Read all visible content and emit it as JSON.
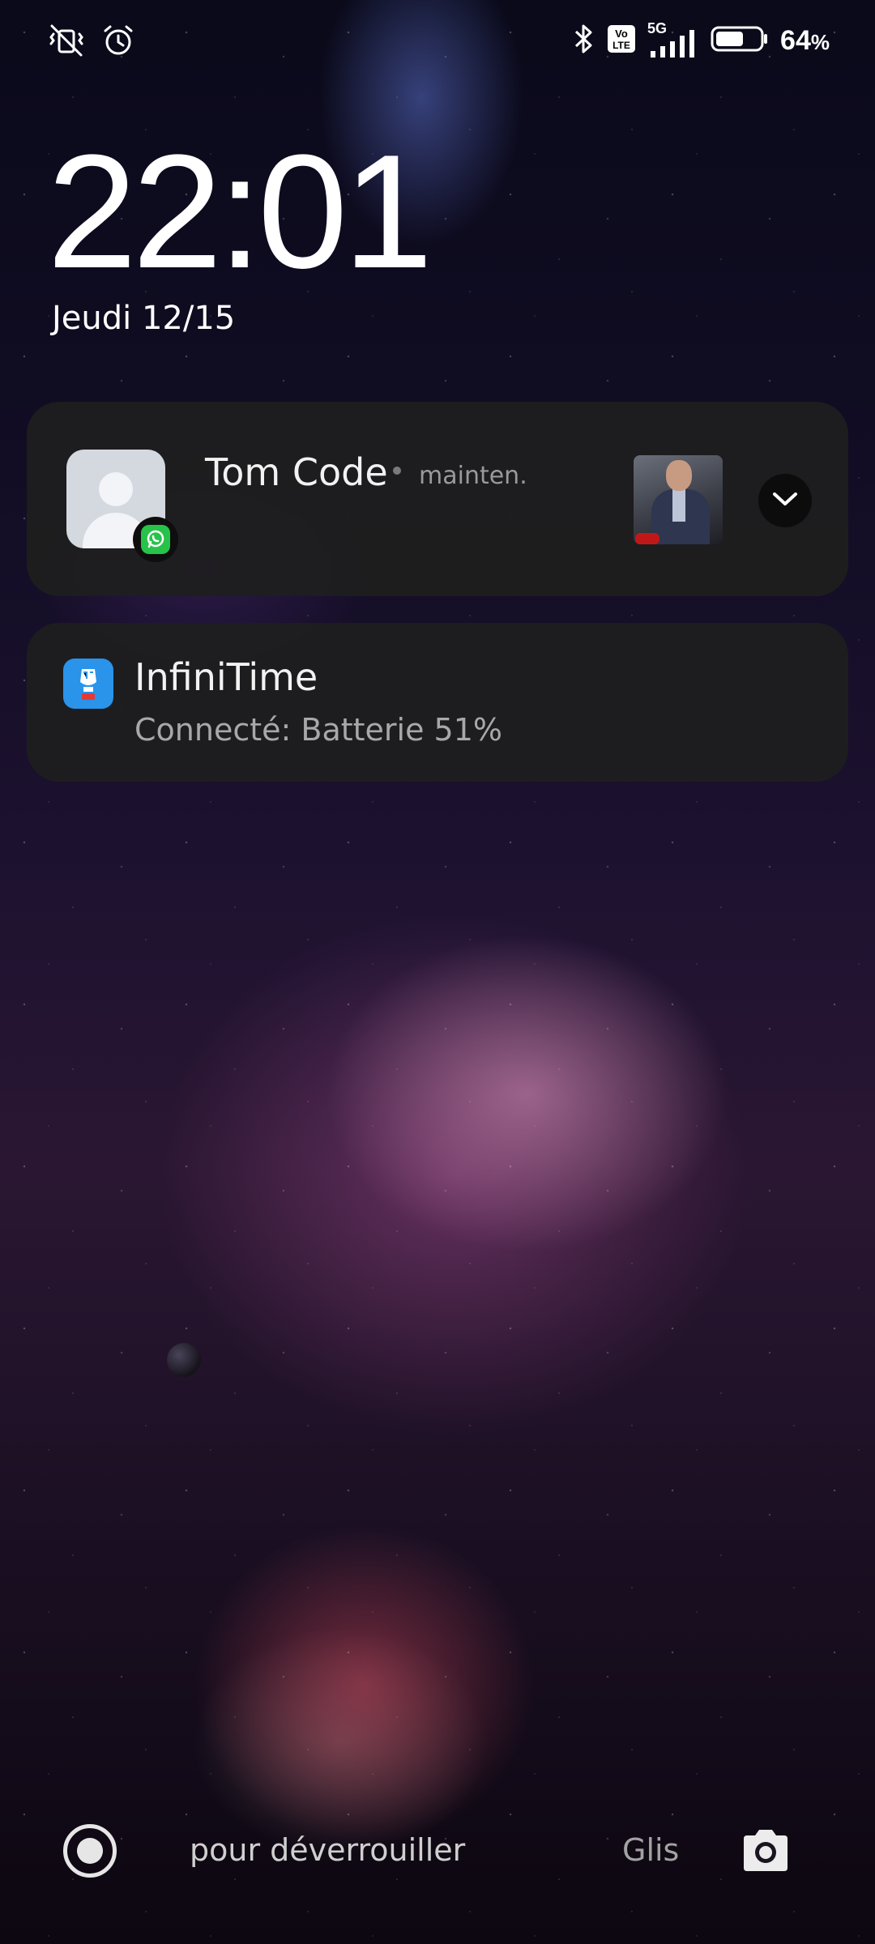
{
  "status_bar": {
    "left_icons": [
      "vibrate-off-icon",
      "alarm-icon"
    ],
    "right_icons": [
      "bluetooth-icon",
      "volte-icon",
      "signal-5g-icon",
      "battery-icon"
    ],
    "network_label": "5G",
    "volte_label": "Vo LTE",
    "battery_value": "64",
    "battery_unit": "%",
    "battery_level": 0.64
  },
  "lockscreen": {
    "time": "22:01",
    "date": "Jeudi 12/15"
  },
  "notifications": [
    {
      "app": "WhatsApp",
      "app_icon": "whatsapp-icon",
      "sender": "Tom Code",
      "time_ago": "mainten.",
      "has_thumbnail": true
    },
    {
      "app_icon": "infinitime-icon",
      "title": "InfiniTime",
      "text": "Connecté: Batterie 51%"
    }
  ],
  "bottom": {
    "unlock_hint": "pour déverrouiller",
    "swipe_hint": "Glis",
    "left_button_icon": "shortcut-circle-icon",
    "right_button_icon": "camera-icon"
  },
  "colors": {
    "whatsapp_green": "#27c24a",
    "infinitime_blue": "#2a93ea",
    "card_bg": "#1e1e1e"
  }
}
